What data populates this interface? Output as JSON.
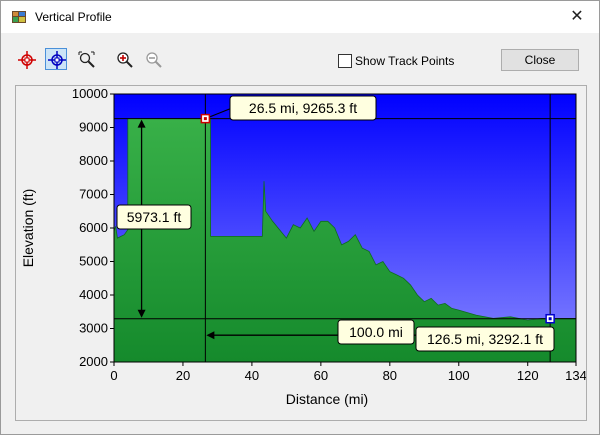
{
  "window": {
    "title": "Vertical Profile",
    "close_glyph": "✕"
  },
  "toolbar": {
    "tools": [
      {
        "name": "marker-red",
        "icon": "crosshair-red-icon"
      },
      {
        "name": "marker-blue",
        "icon": "crosshair-blue-icon",
        "active": true
      },
      {
        "name": "zoom-area",
        "icon": "zoom-area-icon"
      },
      {
        "name": "zoom-in",
        "icon": "zoom-in-icon"
      },
      {
        "name": "zoom-out",
        "icon": "zoom-out-icon",
        "disabled": true
      }
    ],
    "show_track_points_label": "Show Track Points",
    "show_track_points_checked": false,
    "close_label": "Close"
  },
  "colors": {
    "sky_top": "#0000ff",
    "sky_bottom": "#8888ff",
    "terrain_top": "#38b048",
    "terrain_bottom": "#158a2c",
    "callout_bg": "#ffffe0",
    "marker_red": "#cc0000",
    "marker_blue": "#0000cc"
  },
  "chart_data": {
    "type": "area",
    "xlabel": "Distance   (mi)",
    "ylabel": "Elevation (ft)",
    "xlim": [
      0,
      134
    ],
    "ylim": [
      2000,
      10000
    ],
    "x_ticks": [
      "0",
      "20",
      "40",
      "60",
      "80",
      "100",
      "120",
      "134"
    ],
    "y_ticks": [
      "2000",
      "3000",
      "4000",
      "5000",
      "6000",
      "7000",
      "8000",
      "9000",
      "10000"
    ],
    "x_tick_values": [
      0,
      20,
      40,
      60,
      80,
      100,
      120,
      134
    ],
    "y_tick_values": [
      2000,
      3000,
      4000,
      5000,
      6000,
      7000,
      8000,
      9000,
      10000
    ],
    "grid": false,
    "profile": {
      "x": [
        0,
        0.5,
        1,
        2,
        3,
        4,
        4.01,
        26.5,
        28,
        28.01,
        43,
        43.5,
        44,
        46,
        50,
        52,
        54,
        56,
        58,
        60,
        62,
        64,
        66,
        68,
        70,
        72,
        74,
        76,
        78,
        80,
        82,
        84,
        86,
        88,
        90,
        92,
        94,
        96,
        98,
        100,
        105,
        110,
        115,
        120,
        124,
        126.5,
        130,
        134
      ],
      "y": [
        5900,
        6050,
        5700,
        5750,
        5800,
        5950,
        9265,
        9265,
        9265,
        5750,
        5750,
        7400,
        6500,
        6200,
        5700,
        6100,
        6000,
        6300,
        5900,
        6200,
        6200,
        6000,
        5500,
        5600,
        5800,
        5400,
        5300,
        4900,
        5000,
        4700,
        4600,
        4500,
        4300,
        4000,
        3800,
        3900,
        3700,
        3750,
        3600,
        3550,
        3400,
        3300,
        3350,
        3250,
        3300,
        3292,
        3300,
        3300
      ]
    },
    "markers": [
      {
        "name": "point-a",
        "x": 26.5,
        "y": 9265.3,
        "color": "red",
        "label": "26.5 mi, 9265.3 ft"
      },
      {
        "name": "point-b",
        "x": 126.5,
        "y": 3292.1,
        "color": "blue",
        "label": "126.5 mi, 3292.1 ft"
      }
    ],
    "measurements": {
      "elevation_delta_label": "5973.1 ft",
      "elevation_delta_x": 8,
      "distance_delta_label": "100.0 mi",
      "distance_delta_y": 2800
    }
  }
}
